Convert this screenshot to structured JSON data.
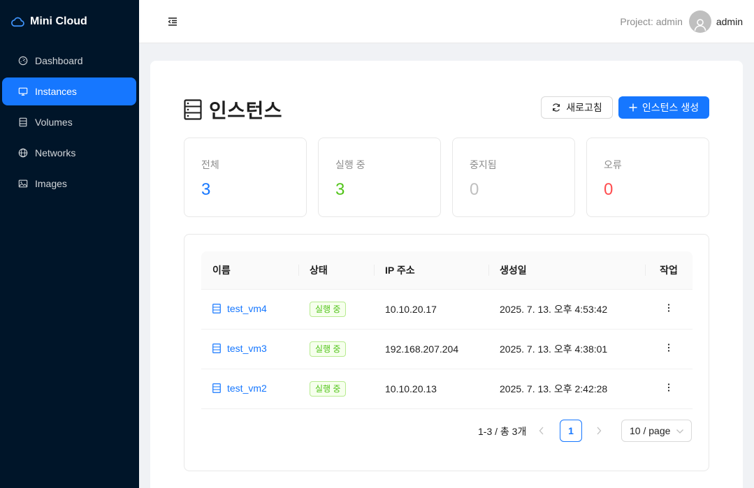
{
  "brand": {
    "name": "Mini Cloud",
    "icon": "cloud-icon"
  },
  "sidebar": {
    "items": [
      {
        "label": "Dashboard",
        "icon": "dashboard-icon",
        "active": false
      },
      {
        "label": "Instances",
        "icon": "desktop-icon",
        "active": true
      },
      {
        "label": "Volumes",
        "icon": "database-icon",
        "active": false
      },
      {
        "label": "Networks",
        "icon": "globe-icon",
        "active": false
      },
      {
        "label": "Images",
        "icon": "picture-icon",
        "active": false
      }
    ]
  },
  "header": {
    "project_label": "Project: admin",
    "username": "admin"
  },
  "page": {
    "title": "인스턴스",
    "refresh_label": "새로고침",
    "create_label": "인스턴스 생성"
  },
  "stats": [
    {
      "label": "전체",
      "value": "3",
      "color": "#1677ff"
    },
    {
      "label": "실행 중",
      "value": "3",
      "color": "#52c41a"
    },
    {
      "label": "중지됨",
      "value": "0",
      "color": "#bfbfbf"
    },
    {
      "label": "오류",
      "value": "0",
      "color": "#ff4d4f"
    }
  ],
  "table": {
    "columns": [
      "이름",
      "상태",
      "IP 주소",
      "생성일",
      "작업"
    ],
    "rows": [
      {
        "name": "test_vm4",
        "status": "실행 중",
        "ip": "10.10.20.17",
        "created": "2025. 7. 13. 오후 4:53:42"
      },
      {
        "name": "test_vm3",
        "status": "실행 중",
        "ip": "192.168.207.204",
        "created": "2025. 7. 13. 오후 4:38:01"
      },
      {
        "name": "test_vm2",
        "status": "실행 중",
        "ip": "10.10.20.13",
        "created": "2025. 7. 13. 오후 2:42:28"
      }
    ]
  },
  "pagination": {
    "total_text": "1-3 / 총 3개",
    "current_page": "1",
    "page_size": "10 / page"
  },
  "colors": {
    "accent": "#1677ff",
    "sidebar_bg": "#001529",
    "success": "#52c41a",
    "error": "#ff4d4f"
  }
}
